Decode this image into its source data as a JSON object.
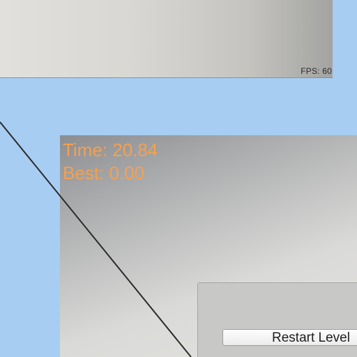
{
  "hud": {
    "fps": "FPS: 60",
    "time": "Time: 20.84",
    "best": "Best: 0.00"
  },
  "menu": {
    "restart_label": "Restart Level"
  },
  "colors": {
    "sky": "#a7cdf2",
    "hud_text": "#f2a152",
    "line": "#2b2b2b"
  }
}
